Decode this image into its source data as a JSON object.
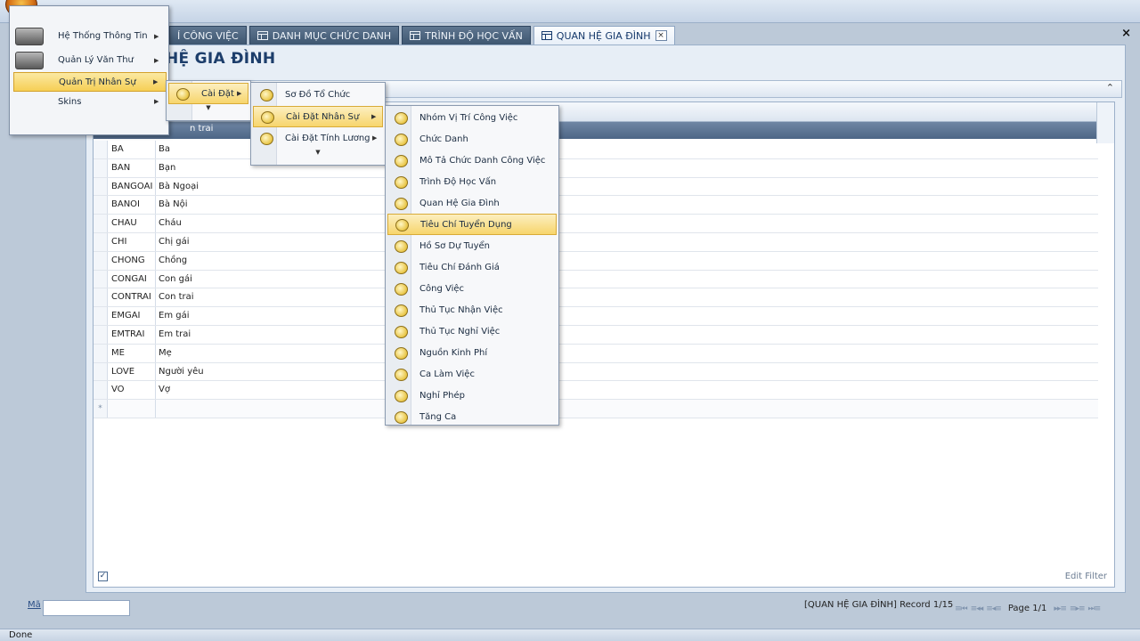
{
  "window": {
    "close_glyph": "×"
  },
  "tabs": [
    {
      "label": "Í CÔNG VIỆC",
      "active": false
    },
    {
      "label": "DANH MỤC CHỨC DANH",
      "active": false
    },
    {
      "label": "TRÌNH ĐỘ HỌC VẤN",
      "active": false
    },
    {
      "label": "QUAN HỆ GIA ĐÌNH",
      "active": true,
      "close": "×"
    }
  ],
  "page": {
    "title": "HỆ GIA ĐÌNH",
    "collapse_glyph": "⌃"
  },
  "grid": {
    "filter_text": "n trai",
    "rows": [
      {
        "code": "BA",
        "name": "Ba"
      },
      {
        "code": "BAN",
        "name": "Bạn"
      },
      {
        "code": "BANGOAI",
        "name": "Bà Ngoại"
      },
      {
        "code": "BANOI",
        "name": "Bà Nội"
      },
      {
        "code": "CHAU",
        "name": "Cháu"
      },
      {
        "code": "CHI",
        "name": "Chị gái"
      },
      {
        "code": "CHONG",
        "name": "Chồng"
      },
      {
        "code": "CONGAI",
        "name": "Con gái"
      },
      {
        "code": "CONTRAI",
        "name": "Con trai"
      },
      {
        "code": "EMGAI",
        "name": "Em gái"
      },
      {
        "code": "EMTRAI",
        "name": "Em trai"
      },
      {
        "code": "ME",
        "name": "Mẹ"
      },
      {
        "code": "LOVE",
        "name": "Người yêu"
      },
      {
        "code": "VO",
        "name": "Vợ"
      }
    ],
    "new_row_glyph": "*",
    "filter_checkbox_glyph": "✓",
    "edit_filter_label": "Edit Filter"
  },
  "footer": {
    "ma_label": "Mã",
    "ma_value": "",
    "record_info": "[QUAN HỆ GIA ĐÌNH] Record 1/15",
    "page_label": "Page 1/1",
    "first_glyph": "≡⏮",
    "prev_page_glyph": "≡◂◂",
    "prev_glyph": "≡◂≡",
    "next_glyph": "▸▸≡",
    "next_page_glyph": "≡▸≡",
    "last_glyph": "⏭≡"
  },
  "status": "Done",
  "app_menu": {
    "items": [
      {
        "label": "Hệ Thống Thông Tin",
        "icon": "system-picture-icon"
      },
      {
        "label": "Quản Lý Văn Thư",
        "icon": "document-picture-icon"
      },
      {
        "label": "Quản Trị Nhân Sự",
        "highlighted": true
      },
      {
        "label": "Skins"
      }
    ],
    "arrow": "▶"
  },
  "submenu_caidat": {
    "items": [
      {
        "label": "Cài Đặt",
        "highlighted": true
      }
    ]
  },
  "submenu_level2": {
    "items": [
      {
        "label": "Sơ Đồ Tổ Chức"
      },
      {
        "label": "Cài Đặt Nhân Sự",
        "highlighted": true
      },
      {
        "label": "Cài Đặt Tính Lương"
      }
    ],
    "more_glyph": "▼"
  },
  "submenu_level3": {
    "items": [
      {
        "label": "Nhóm Vị Trí Công Việc"
      },
      {
        "label": "Chức Danh"
      },
      {
        "label": "Mô Tả Chức Danh Công Việc"
      },
      {
        "label": "Trình Độ Học Vấn"
      },
      {
        "label": "Quan Hệ Gia Đình"
      },
      {
        "label": "Tiêu Chí Tuyển Dụng",
        "highlighted": true
      },
      {
        "label": "Hồ Sơ Dự Tuyển"
      },
      {
        "label": "Tiêu Chí Đánh Giá"
      },
      {
        "label": "Công Việc"
      },
      {
        "label": "Thủ Tục Nhận Việc"
      },
      {
        "label": "Thủ Tục Nghỉ Việc"
      },
      {
        "label": "Nguồn Kinh Phí"
      },
      {
        "label": "Ca Làm Việc"
      },
      {
        "label": "Nghỉ Phép"
      },
      {
        "label": "Tăng Ca"
      }
    ]
  },
  "colors": {
    "accent": "#f6cf55",
    "tab_active_text": "#15396b",
    "title": "#1d3e6b"
  }
}
